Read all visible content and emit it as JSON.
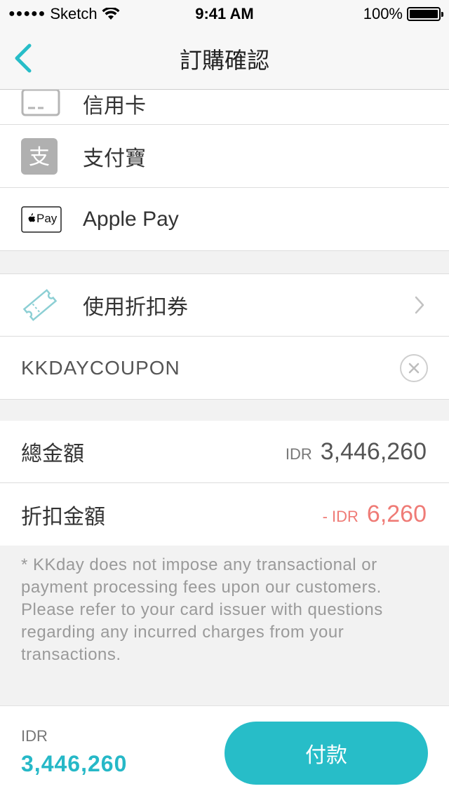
{
  "status_bar": {
    "carrier": "Sketch",
    "signal_dots": "●●●●●",
    "time": "9:41 AM",
    "battery": "100%"
  },
  "nav": {
    "title": "訂購確認"
  },
  "payment_methods": [
    {
      "label": "信用卡",
      "icon": "credit-card-icon"
    },
    {
      "label": "支付寶",
      "icon": "alipay-icon"
    },
    {
      "label": "Apple Pay",
      "icon": "apple-pay-icon",
      "badge": "Pay"
    }
  ],
  "coupon": {
    "label": "使用折扣券",
    "code": "KKDAYCOUPON"
  },
  "summary": {
    "total_label": "總金額",
    "total_currency": "IDR",
    "total_amount": "3,446,260",
    "discount_label": "折扣金額",
    "discount_currency": "- IDR",
    "discount_amount": "6,260"
  },
  "note": "* KKday does not impose any transactional or payment processing fees upon our customers. Please refer to your card issuer with questions regarding any incurred charges from your transactions.",
  "footer": {
    "currency": "IDR",
    "amount": "3,446,260",
    "pay_label": "付款"
  },
  "colors": {
    "accent": "#27bdc8",
    "discount": "#ef7b76"
  }
}
